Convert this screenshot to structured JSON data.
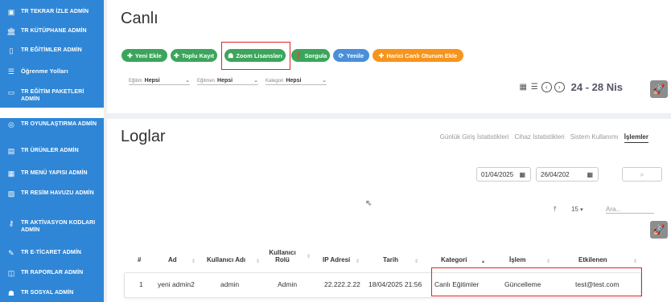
{
  "sidebar": {
    "items_top": [
      {
        "label": "TR TEKRAR İZLE ADMİN",
        "icon": "video-icon",
        "glyph": "▣"
      },
      {
        "label": "TR KÜTÜPHANE ADMİN",
        "icon": "library-icon",
        "glyph": "🏛"
      },
      {
        "label": "TR EĞİTİMLER ADMİN",
        "icon": "book-icon",
        "glyph": "▯"
      },
      {
        "label": "Öğrenme Yolları",
        "icon": "list-icon",
        "glyph": "☰"
      },
      {
        "label": "TR EĞİTİM PAKETLERİ ADMİN",
        "icon": "folder-icon",
        "glyph": "▭"
      }
    ],
    "items_bottom": [
      {
        "label": "TR OYUNLAŞTIRMA ADMİN",
        "icon": "gamepad-icon",
        "glyph": "◎"
      },
      {
        "label": "TR ÜRÜNLER ADMİN",
        "icon": "store-icon",
        "glyph": "▤"
      },
      {
        "label": "TR MENÜ YAPISI ADMİN",
        "icon": "menu-grid-icon",
        "glyph": "▦"
      },
      {
        "label": "TR RESİM HAVUZU ADMİN",
        "icon": "image-icon",
        "glyph": "▨"
      },
      {
        "label": "TR AKTİVASYON KODLARI ADMİN",
        "icon": "key-icon",
        "glyph": "⚷"
      },
      {
        "label": "TR E-TİCARET ADMİN",
        "icon": "edit-icon",
        "glyph": "✎"
      },
      {
        "label": "TR RAPORLAR ADMİN",
        "icon": "report-icon",
        "glyph": "◫"
      },
      {
        "label": "TR SOSYAL ADMİN",
        "icon": "people-icon",
        "glyph": "☗"
      }
    ]
  },
  "live": {
    "title": "Canlı",
    "buttons": {
      "yeni_ekle": "Yeni Ekle",
      "toplu_kayit": "Toplu Kayıt",
      "zoom": "Zoom Lisansları",
      "sorgula": "Sorgula",
      "yenile": "Yenile",
      "harici": "Harici Canlı Oturum Ekle"
    },
    "filters": [
      {
        "label": "Eğitim",
        "value": "Hepsi"
      },
      {
        "label": "Eğitmen",
        "value": "Hepsi"
      },
      {
        "label": "Kategori",
        "value": "Hepsi"
      }
    ],
    "date_range": "24 - 28 Nis"
  },
  "logs": {
    "title": "Loglar",
    "tabs": [
      "Günlük Giriş İstatistikleri",
      "Cihaz İstatistikleri",
      "Sistem Kullanımı",
      "İşlemler"
    ],
    "active_tab": "İşlemler",
    "date_from": "01/04/2025",
    "date_to": "26/04/202",
    "page_size": "15",
    "search_placeholder": "Ara...",
    "columns": [
      "#",
      "Ad",
      "Kullanıcı Adı",
      "Kullanıcı Rolü",
      "IP Adresi",
      "Tarih",
      "Kategori",
      "İşlem",
      "Etkilenen"
    ],
    "rows": [
      {
        "no": "1",
        "ad": "yeni admin2",
        "kullanici": "admin",
        "rol": "Admin",
        "ip": "22.222.2.22",
        "tarih": "18/04/2025 21:56",
        "kategori": "Canlı Eğitimler",
        "islem": "Güncelleme",
        "etkilenen": "test@test.com"
      }
    ]
  },
  "colors": {
    "sidebar": "#2f86d6",
    "green": "#3ca55c",
    "blue": "#4a8fd8",
    "orange": "#f7941d",
    "highlight": "#e02424"
  }
}
